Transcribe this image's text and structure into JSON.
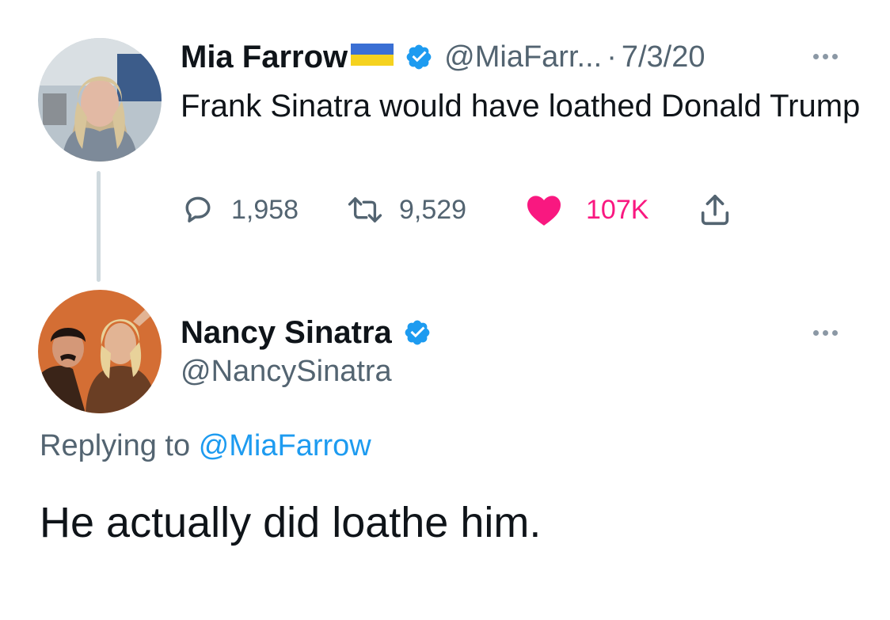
{
  "tweet1": {
    "author_name": "Mia Farrow",
    "handle": "@MiaFarr...",
    "separator": "·",
    "date": "7/3/20",
    "text": "Frank Sinatra would have loathed Donald Trump",
    "reply_count": "1,958",
    "retweet_count": "9,529",
    "like_count": "107K",
    "liked": true,
    "flag_colors": {
      "top": "#3a6fd4",
      "bottom": "#f5d21f"
    }
  },
  "tweet2": {
    "author_name": "Nancy Sinatra",
    "handle": "@NancySinatra",
    "replying_prefix": "Replying to",
    "replying_to": "@MiaFarrow",
    "text": "He actually did loathe him."
  },
  "icons": [
    "verified-icon",
    "more-icon",
    "reply-icon",
    "retweet-icon",
    "like-icon",
    "share-icon"
  ],
  "colors": {
    "text_primary": "#0f1419",
    "text_secondary": "#536471",
    "accent": "#1d9bf0",
    "like": "#f91880",
    "thread_line": "#cfd9de"
  }
}
